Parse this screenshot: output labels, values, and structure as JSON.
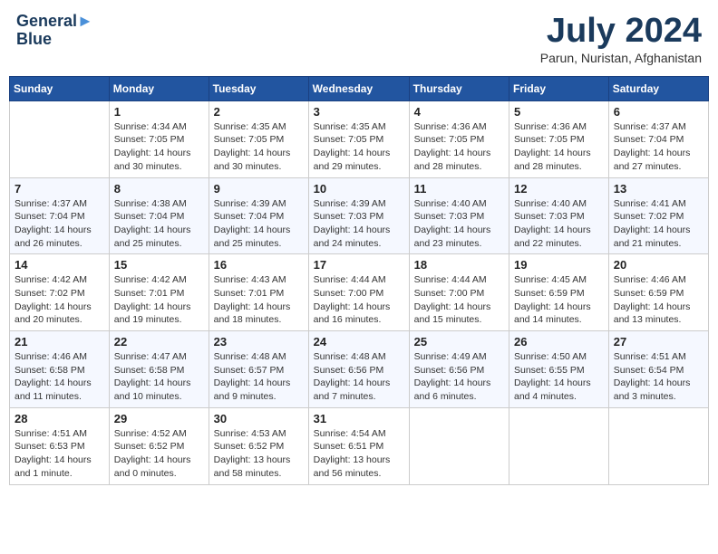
{
  "header": {
    "logo_line1": "General",
    "logo_line2": "Blue",
    "title": "July 2024",
    "subtitle": "Parun, Nuristan, Afghanistan"
  },
  "weekdays": [
    "Sunday",
    "Monday",
    "Tuesday",
    "Wednesday",
    "Thursday",
    "Friday",
    "Saturday"
  ],
  "weeks": [
    [
      {
        "day": "",
        "info": ""
      },
      {
        "day": "1",
        "info": "Sunrise: 4:34 AM\nSunset: 7:05 PM\nDaylight: 14 hours\nand 30 minutes."
      },
      {
        "day": "2",
        "info": "Sunrise: 4:35 AM\nSunset: 7:05 PM\nDaylight: 14 hours\nand 30 minutes."
      },
      {
        "day": "3",
        "info": "Sunrise: 4:35 AM\nSunset: 7:05 PM\nDaylight: 14 hours\nand 29 minutes."
      },
      {
        "day": "4",
        "info": "Sunrise: 4:36 AM\nSunset: 7:05 PM\nDaylight: 14 hours\nand 28 minutes."
      },
      {
        "day": "5",
        "info": "Sunrise: 4:36 AM\nSunset: 7:05 PM\nDaylight: 14 hours\nand 28 minutes."
      },
      {
        "day": "6",
        "info": "Sunrise: 4:37 AM\nSunset: 7:04 PM\nDaylight: 14 hours\nand 27 minutes."
      }
    ],
    [
      {
        "day": "7",
        "info": "Sunrise: 4:37 AM\nSunset: 7:04 PM\nDaylight: 14 hours\nand 26 minutes."
      },
      {
        "day": "8",
        "info": "Sunrise: 4:38 AM\nSunset: 7:04 PM\nDaylight: 14 hours\nand 25 minutes."
      },
      {
        "day": "9",
        "info": "Sunrise: 4:39 AM\nSunset: 7:04 PM\nDaylight: 14 hours\nand 25 minutes."
      },
      {
        "day": "10",
        "info": "Sunrise: 4:39 AM\nSunset: 7:03 PM\nDaylight: 14 hours\nand 24 minutes."
      },
      {
        "day": "11",
        "info": "Sunrise: 4:40 AM\nSunset: 7:03 PM\nDaylight: 14 hours\nand 23 minutes."
      },
      {
        "day": "12",
        "info": "Sunrise: 4:40 AM\nSunset: 7:03 PM\nDaylight: 14 hours\nand 22 minutes."
      },
      {
        "day": "13",
        "info": "Sunrise: 4:41 AM\nSunset: 7:02 PM\nDaylight: 14 hours\nand 21 minutes."
      }
    ],
    [
      {
        "day": "14",
        "info": "Sunrise: 4:42 AM\nSunset: 7:02 PM\nDaylight: 14 hours\nand 20 minutes."
      },
      {
        "day": "15",
        "info": "Sunrise: 4:42 AM\nSunset: 7:01 PM\nDaylight: 14 hours\nand 19 minutes."
      },
      {
        "day": "16",
        "info": "Sunrise: 4:43 AM\nSunset: 7:01 PM\nDaylight: 14 hours\nand 18 minutes."
      },
      {
        "day": "17",
        "info": "Sunrise: 4:44 AM\nSunset: 7:00 PM\nDaylight: 14 hours\nand 16 minutes."
      },
      {
        "day": "18",
        "info": "Sunrise: 4:44 AM\nSunset: 7:00 PM\nDaylight: 14 hours\nand 15 minutes."
      },
      {
        "day": "19",
        "info": "Sunrise: 4:45 AM\nSunset: 6:59 PM\nDaylight: 14 hours\nand 14 minutes."
      },
      {
        "day": "20",
        "info": "Sunrise: 4:46 AM\nSunset: 6:59 PM\nDaylight: 14 hours\nand 13 minutes."
      }
    ],
    [
      {
        "day": "21",
        "info": "Sunrise: 4:46 AM\nSunset: 6:58 PM\nDaylight: 14 hours\nand 11 minutes."
      },
      {
        "day": "22",
        "info": "Sunrise: 4:47 AM\nSunset: 6:58 PM\nDaylight: 14 hours\nand 10 minutes."
      },
      {
        "day": "23",
        "info": "Sunrise: 4:48 AM\nSunset: 6:57 PM\nDaylight: 14 hours\nand 9 minutes."
      },
      {
        "day": "24",
        "info": "Sunrise: 4:48 AM\nSunset: 6:56 PM\nDaylight: 14 hours\nand 7 minutes."
      },
      {
        "day": "25",
        "info": "Sunrise: 4:49 AM\nSunset: 6:56 PM\nDaylight: 14 hours\nand 6 minutes."
      },
      {
        "day": "26",
        "info": "Sunrise: 4:50 AM\nSunset: 6:55 PM\nDaylight: 14 hours\nand 4 minutes."
      },
      {
        "day": "27",
        "info": "Sunrise: 4:51 AM\nSunset: 6:54 PM\nDaylight: 14 hours\nand 3 minutes."
      }
    ],
    [
      {
        "day": "28",
        "info": "Sunrise: 4:51 AM\nSunset: 6:53 PM\nDaylight: 14 hours\nand 1 minute."
      },
      {
        "day": "29",
        "info": "Sunrise: 4:52 AM\nSunset: 6:52 PM\nDaylight: 14 hours\nand 0 minutes."
      },
      {
        "day": "30",
        "info": "Sunrise: 4:53 AM\nSunset: 6:52 PM\nDaylight: 13 hours\nand 58 minutes."
      },
      {
        "day": "31",
        "info": "Sunrise: 4:54 AM\nSunset: 6:51 PM\nDaylight: 13 hours\nand 56 minutes."
      },
      {
        "day": "",
        "info": ""
      },
      {
        "day": "",
        "info": ""
      },
      {
        "day": "",
        "info": ""
      }
    ]
  ]
}
